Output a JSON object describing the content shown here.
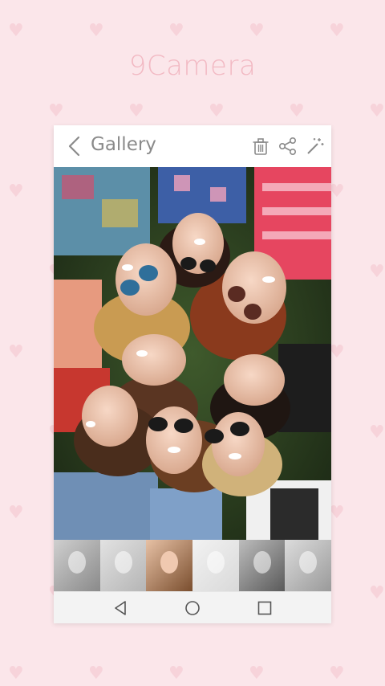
{
  "app": {
    "title": "9Camera"
  },
  "toolbar": {
    "back_icon": "chevron-left-icon",
    "title": "Gallery",
    "actions": [
      "trash-icon",
      "share-icon",
      "magic-wand-icon"
    ]
  },
  "photo": {
    "description_icon": "photo-image"
  },
  "thumbnails": [
    {
      "icon": "thumbnail-image"
    },
    {
      "icon": "thumbnail-image"
    },
    {
      "icon": "thumbnail-image"
    },
    {
      "icon": "thumbnail-image"
    },
    {
      "icon": "thumbnail-image"
    },
    {
      "icon": "thumbnail-image"
    }
  ],
  "navigation": [
    "back-triangle-icon",
    "home-circle-icon",
    "recents-square-icon"
  ],
  "colors": {
    "background": "#fbe6ea",
    "title": "#f2b9c3",
    "toolbar_text": "#8a8a8a"
  }
}
